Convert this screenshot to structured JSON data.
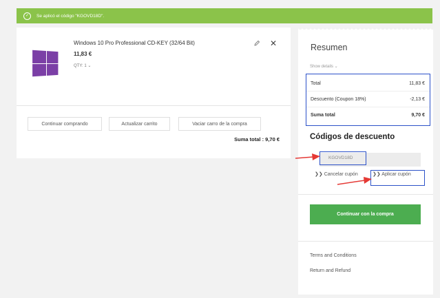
{
  "banner": {
    "message": "Se aplicó el código \"KGOVD18D\".",
    "check_glyph": "✓",
    "color": "#8bc34a"
  },
  "cart": {
    "product": {
      "title": "Windows 10 Pro Professional CD-KEY (32/64 Bit)",
      "price": "11,83 €",
      "qty": "QTY: 1 ⌄"
    },
    "buttons": {
      "continue": "Continuar comprando",
      "update": "Actualizar carrito",
      "empty": "Vaciar carro de la compra"
    },
    "subtotal": "Suma total : 9,70 €"
  },
  "summary": {
    "title": "Resumen",
    "show_details": "Show details ⌄",
    "rows": [
      {
        "label": "Total",
        "value": "11,83 €"
      },
      {
        "label": "Descuento (Coupon 18%)",
        "value": "-2,13 €"
      },
      {
        "label": "Suma total",
        "value": "9,70 €"
      }
    ],
    "discount_heading": "Códigos de descuento",
    "coupon_value": "KGOVD18D",
    "cancel_link": "Cancelar cupón",
    "apply_link": "Aplicar cupón",
    "link_prefix": "❯❯",
    "checkout_button": "Continuar con la compra",
    "footer_links": [
      "Terms and Conditions",
      "Return and Refund"
    ],
    "accent_green": "#4cad50",
    "highlight_blue": "#2a50c8",
    "arrow_red": "#e53935"
  },
  "icons": [
    "check-circle-icon",
    "pencil-icon",
    "close-icon",
    "windows-logo-icon",
    "double-chevron-icon"
  ]
}
